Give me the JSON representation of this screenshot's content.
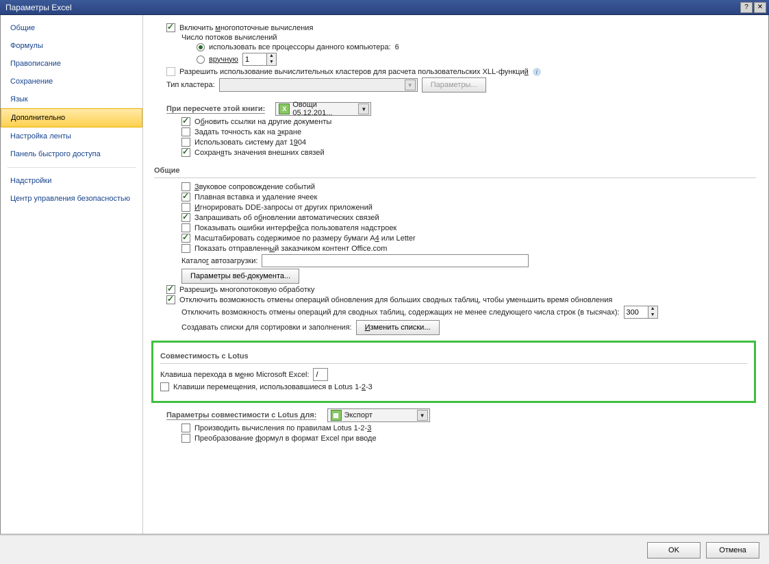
{
  "titlebar": {
    "title": "Параметры Excel"
  },
  "sidebar": {
    "items": [
      "Общие",
      "Формулы",
      "Правописание",
      "Сохранение",
      "Язык",
      "Дополнительно",
      "Настройка ленты",
      "Панель быстрого доступа",
      "Надстройки",
      "Центр управления безопасностью"
    ],
    "selected_index": 5
  },
  "calc": {
    "multithread_label": "Включить многопоточные вычисления",
    "threads_label": "Число потоков вычислений",
    "use_all_label": "использовать все процессоры данного компьютера:",
    "processor_count": "6",
    "manual_label": "вручную",
    "manual_value": "1",
    "allow_cluster_label": "Разрешить использование вычислительных кластеров для расчета пользовательских XLL-функций",
    "cluster_type_label": "Тип кластера:",
    "params_btn": "Параметры..."
  },
  "recalc": {
    "header_label": "При пересчете этой книги:",
    "workbook_name": "Овощи 05.12.201...",
    "update_links": "Обновить ссылки на другие документы",
    "precision": "Задать точность как на экране",
    "date1904": "Использовать систему дат 1904",
    "save_ext": "Сохранять значения внешних связей"
  },
  "general": {
    "header": "Общие",
    "sound": "Звуковое сопровождение событий",
    "smooth_insert": "Плавная вставка и удаление ячеек",
    "ignore_dde": "Игнорировать DDE-запросы от других приложений",
    "ask_update": "Запрашивать об обновлении автоматических связей",
    "show_addin_err": "Показывать ошибки интерфейса пользователя надстроек",
    "scale_a4": "Масштабировать содержимое по размеру бумаги A4 или Letter",
    "show_office_content": "Показать отправленный заказчиком контент Office.com",
    "startup_label": "Каталог автозагрузки:",
    "startup_value": "",
    "web_params_btn": "Параметры веб-документа...",
    "multithread_proc": "Разрешить многопотоковую обработку",
    "disable_undo_large": "Отключить возможность отмены операций обновления для больших сводных таблиц, чтобы уменьшить время обновления",
    "disable_undo_rows_label": "Отключить возможность отмены операций для сводных таблиц, содержащих не менее следующего числа строк (в тысячах):",
    "disable_undo_rows_value": "300",
    "custom_lists_label": "Создавать списки для сортировки и заполнения:",
    "edit_lists_btn": "Изменить списки..."
  },
  "lotus": {
    "header": "Совместимость с Lotus",
    "menu_key_label": "Клавиша перехода в меню Microsoft Excel:",
    "menu_key_value": "/",
    "nav_keys": "Клавиши перемещения, использовавшиеся в Lotus 1-2-3"
  },
  "lotus2": {
    "header_label": "Параметры совместимости с Lotus для:",
    "sheet": "Экспорт",
    "calc_rules": "Производить вычисления по правилам Lotus 1-2-3",
    "formula_convert": "Преобразование формул в формат Excel при вводе"
  },
  "buttons": {
    "ok": "OK",
    "cancel": "Отмена"
  }
}
